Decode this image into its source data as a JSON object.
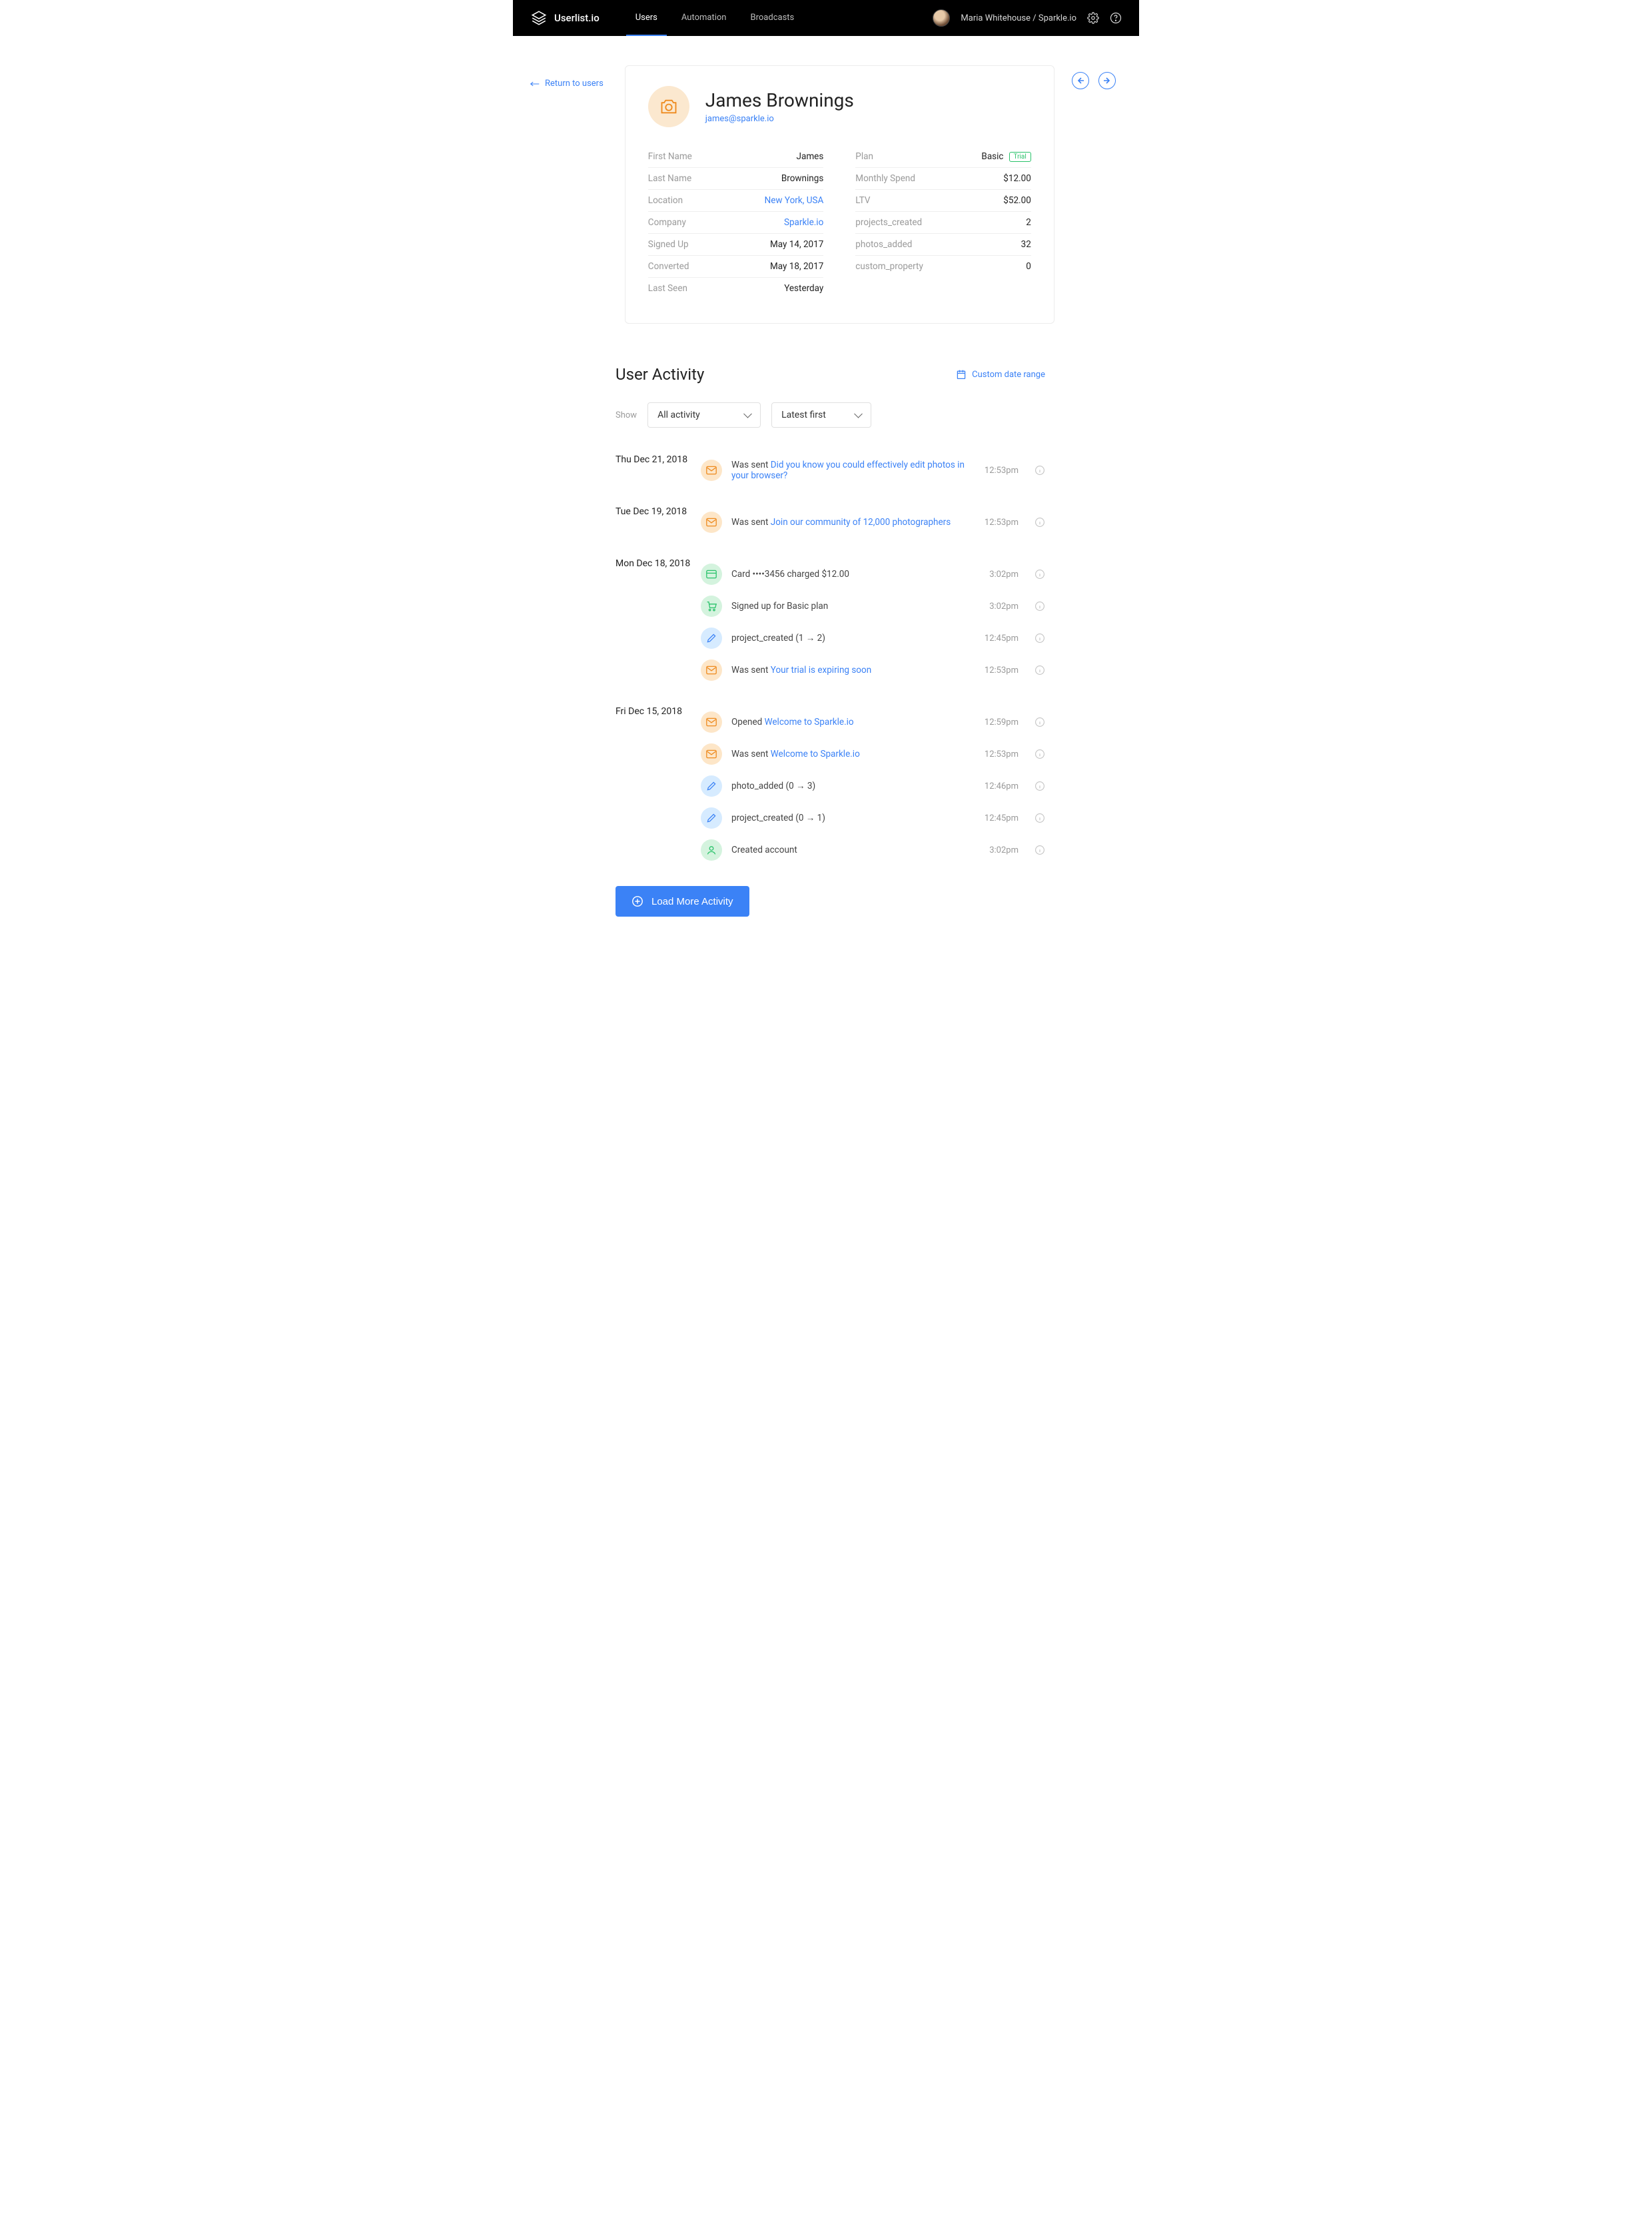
{
  "nav": {
    "brand": "Userlist.io",
    "tabs": [
      "Users",
      "Automation",
      "Broadcasts"
    ],
    "active_tab_index": 0,
    "account": "Maria Whitehouse / Sparkle.io"
  },
  "return_link": "Return to users",
  "profile": {
    "name": "James Brownings",
    "email": "james@sparkle.io",
    "left_details": [
      {
        "label": "First Name",
        "value": "James",
        "link": false
      },
      {
        "label": "Last Name",
        "value": "Brownings",
        "link": false
      },
      {
        "label": "Location",
        "value": "New York, USA",
        "link": true
      },
      {
        "label": "Company",
        "value": "Sparkle.io",
        "link": true
      },
      {
        "label": "Signed Up",
        "value": "May 14, 2017",
        "link": false
      },
      {
        "label": "Converted",
        "value": "May 18, 2017",
        "link": false
      },
      {
        "label": "Last Seen",
        "value": "Yesterday",
        "link": false
      }
    ],
    "right_details": [
      {
        "label": "Plan",
        "value": "Basic",
        "badge": "Trial"
      },
      {
        "label": "Monthly Spend",
        "value": "$12.00"
      },
      {
        "label": "LTV",
        "value": "$52.00"
      },
      {
        "label": "projects_created",
        "value": "2"
      },
      {
        "label": "photos_added",
        "value": "32"
      },
      {
        "label": "custom_property",
        "value": "0"
      }
    ]
  },
  "activity": {
    "title": "User Activity",
    "date_range": "Custom date range",
    "filter_label": "Show",
    "filter_type": "All activity",
    "filter_sort": "Latest first",
    "load_more": "Load More Activity",
    "days": [
      {
        "date": "Thu Dec 21, 2018",
        "items": [
          {
            "icon": "mail",
            "prefix": "Was sent",
            "link": "Did you know you could effectively edit photos in your browser?",
            "time": "12:53pm"
          }
        ]
      },
      {
        "date": "Tue Dec 19, 2018",
        "items": [
          {
            "icon": "mail",
            "prefix": "Was sent",
            "link": "Join our community of 12,000 photographers",
            "time": "12:53pm"
          }
        ]
      },
      {
        "date": "Mon Dec 18, 2018",
        "items": [
          {
            "icon": "card",
            "text": "Card ••••3456 charged $12.00",
            "time": "3:02pm"
          },
          {
            "icon": "cart",
            "text": "Signed up for Basic plan",
            "time": "3:02pm"
          },
          {
            "icon": "pencil",
            "text": "project_created (1 → 2)",
            "time": "12:45pm"
          },
          {
            "icon": "mail",
            "prefix": "Was sent",
            "link": "Your trial is expiring soon",
            "time": "12:53pm"
          }
        ]
      },
      {
        "date": "Fri Dec 15, 2018",
        "items": [
          {
            "icon": "mail",
            "prefix": "Opened",
            "link": "Welcome to Sparkle.io",
            "time": "12:59pm"
          },
          {
            "icon": "mail",
            "prefix": "Was sent",
            "link": "Welcome to Sparkle.io",
            "time": "12:53pm"
          },
          {
            "icon": "pencil",
            "text": "photo_added (0 → 3)",
            "time": "12:46pm"
          },
          {
            "icon": "pencil",
            "text": "project_created (0 → 1)",
            "time": "12:45pm"
          },
          {
            "icon": "user",
            "text": "Created account",
            "time": "3:02pm"
          }
        ]
      }
    ]
  }
}
